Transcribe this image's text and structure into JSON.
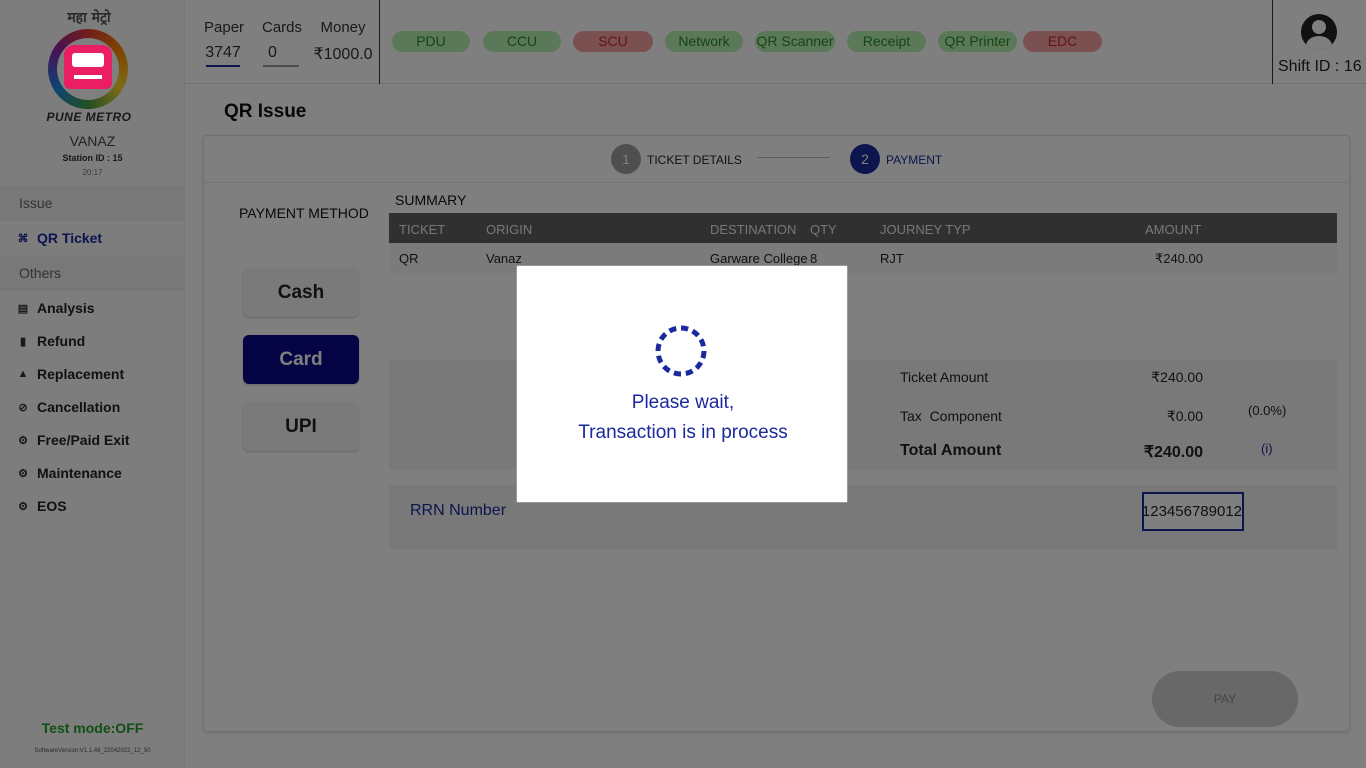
{
  "sidebar": {
    "logo_hindi": "महा मेट्रो",
    "logo_text": "PUNE METRO",
    "station_name": "VANAZ",
    "station_id": "Station ID : 15",
    "time": "20:17",
    "sections": [
      {
        "label": "Issue",
        "items": [
          {
            "label": "QR Ticket",
            "icon": "qr-icon",
            "active": true
          }
        ]
      },
      {
        "label": "Others",
        "items": [
          {
            "label": "Analysis",
            "icon": "chart-icon"
          },
          {
            "label": "Refund",
            "icon": "receipt-icon"
          },
          {
            "label": "Replacement",
            "icon": "replace-icon"
          },
          {
            "label": "Cancellation",
            "icon": "cancel-icon"
          },
          {
            "label": "Free/Paid Exit",
            "icon": "gear-icon"
          },
          {
            "label": "Maintenance",
            "icon": "gear-icon"
          },
          {
            "label": "EOS",
            "icon": "gear-icon"
          }
        ]
      }
    ],
    "test_mode": "Test mode:OFF",
    "software_version": "SoftwareVersion:V1.1.48_22042022_12_50"
  },
  "topbar": {
    "paper": {
      "label": "Paper",
      "value": "3747"
    },
    "cards": {
      "label": "Cards",
      "value": "0"
    },
    "money": {
      "label": "Money",
      "value": "₹1000.0"
    },
    "devices": [
      {
        "label": "PDU",
        "status": "ok"
      },
      {
        "label": "CCU",
        "status": "ok"
      },
      {
        "label": "SCU",
        "status": "error"
      },
      {
        "label": "Network",
        "status": "ok"
      },
      {
        "label": "QR Scanner",
        "status": "ok"
      },
      {
        "label": "Receipt",
        "status": "ok"
      },
      {
        "label": "QR Printer",
        "status": "ok"
      },
      {
        "label": "EDC",
        "status": "error"
      }
    ],
    "shift_id": "Shift ID : 16"
  },
  "main": {
    "page_title": "QR Issue",
    "steps": [
      {
        "number": "1",
        "label": "TICKET DETAILS",
        "active": false
      },
      {
        "number": "2",
        "label": "PAYMENT",
        "active": true
      }
    ],
    "payment_method_title": "PAYMENT METHOD",
    "payment_methods": [
      "Cash",
      "Card",
      "UPI"
    ],
    "selected_payment_method": "Card",
    "summary_label": "SUMMARY",
    "table": {
      "headers": [
        "TICKET",
        "ORIGIN",
        "DESTINATION",
        "QTY",
        "JOURNEY TYP",
        "AMOUNT"
      ],
      "rows": [
        [
          "QR",
          "Vanaz",
          "Garware College",
          "8",
          "RJT",
          "₹240.00"
        ]
      ]
    },
    "ticket_amount": {
      "label": "Ticket Amount",
      "value": "₹240.00"
    },
    "tax_component": {
      "label": "Tax  Component",
      "value": "₹0.00",
      "percent": "(0.0%)"
    },
    "total_amount": {
      "label": "Total Amount",
      "value": "₹240.00",
      "info": "(i)"
    },
    "rrn": {
      "label": "RRN Number",
      "value": "123456789012"
    },
    "pay_button": "PAY"
  },
  "modal": {
    "line1": "Please wait,",
    "line2": "Transaction is in process"
  },
  "colors": {
    "accent": "#1a2a9c",
    "ok_pill": "#b7f2b0",
    "error_pill": "#f5a0a0",
    "card_active": "#0a0a8a",
    "test_mode": "#1e9e2a"
  }
}
